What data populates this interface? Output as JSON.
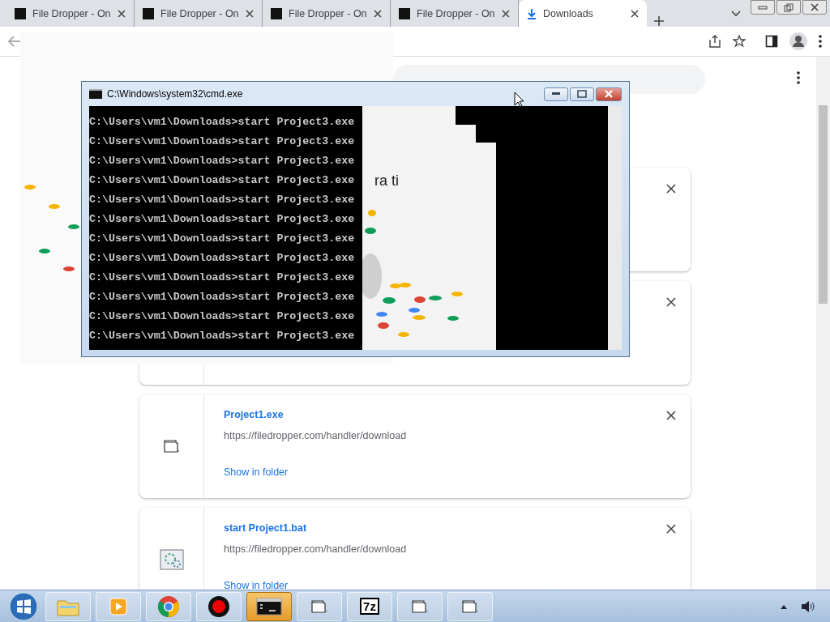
{
  "browser": {
    "tabs": [
      {
        "title": "File Dropper - On",
        "kind": "site",
        "selected": false
      },
      {
        "title": "File Dropper - On",
        "kind": "site",
        "selected": false
      },
      {
        "title": "File Dropper - On",
        "kind": "site",
        "selected": false
      },
      {
        "title": "File Dropper - On",
        "kind": "site",
        "selected": false
      },
      {
        "title": "Downloads",
        "kind": "download",
        "selected": true
      }
    ]
  },
  "downloads": [
    {
      "closable": true
    },
    {
      "closable": true
    },
    {
      "kind": "exe",
      "name": "Project1.exe",
      "url": "https://filedropper.com/handler/download",
      "action": "Show in folder",
      "closable": true
    },
    {
      "kind": "bat",
      "name": "start Project1.bat",
      "url": "https://filedropper.com/handler/download",
      "action": "Show in folder",
      "closable": true
    }
  ],
  "console": {
    "title": "C:\\Windows\\system32\\cmd.exe",
    "overlay_text": "ra ti",
    "lines": [
      "C:\\Users\\vm1\\Downloads>start Project3.exe",
      "C:\\Users\\vm1\\Downloads>start Project3.exe",
      "C:\\Users\\vm1\\Downloads>start Project3.exe",
      "C:\\Users\\vm1\\Downloads>start Project3.exe",
      "C:\\Users\\vm1\\Downloads>start Project3.exe",
      "C:\\Users\\vm1\\Downloads>start Project3.exe",
      "C:\\Users\\vm1\\Downloads>start Project3.exe",
      "C:\\Users\\vm1\\Downloads>start Project3.exe",
      "C:\\Users\\vm1\\Downloads>start Project3.exe",
      "C:\\Users\\vm1\\Downloads>start Project3.exe",
      "C:\\Users\\vm1\\Downloads>start Project3.exe",
      "C:\\Users\\vm1\\Downloads>start Project3.exe"
    ]
  },
  "taskbar": {
    "items": [
      {
        "kind": "explorer",
        "active": false
      },
      {
        "kind": "media",
        "active": false
      },
      {
        "kind": "chrome",
        "active": false
      },
      {
        "kind": "record",
        "active": false
      },
      {
        "kind": "console",
        "active": true
      },
      {
        "kind": "window",
        "active": false
      },
      {
        "kind": "archive",
        "label": "7z",
        "active": false
      },
      {
        "kind": "window",
        "active": false
      },
      {
        "kind": "window",
        "active": false
      }
    ]
  }
}
